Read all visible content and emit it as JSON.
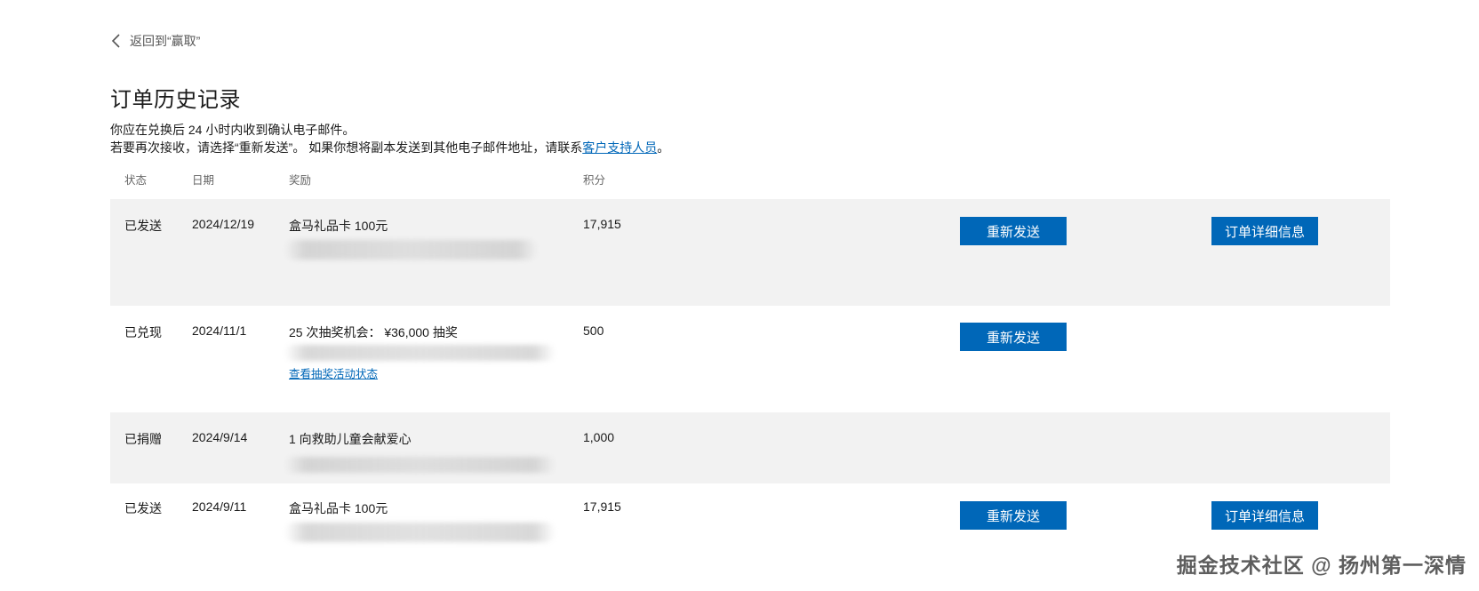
{
  "back": {
    "label": "返回到“赢取”"
  },
  "title": "订单历史记录",
  "intro": {
    "line1": "你应在兑换后 24 小时内收到确认电子邮件。",
    "line2_prefix": "若要再次接收，请选择“重新发送”。 如果你想将副本发送到其他电子邮件地址，请联系",
    "support_link": "客户支持人员",
    "line2_suffix": "。"
  },
  "columns": {
    "status": "状态",
    "date": "日期",
    "reward": "奖励",
    "points": "积分"
  },
  "orders": [
    {
      "status": "已发送",
      "date": "2024/12/19",
      "reward": "盒马礼品卡 100元",
      "points": "17,915",
      "resend": "重新发送",
      "details": "订单详细信息"
    },
    {
      "status": "已兑现",
      "date": "2024/11/1",
      "reward": "25 次抽奖机会： ¥36,000 抽奖",
      "points": "500",
      "resend": "重新发送",
      "link": "查看抽奖活动状态"
    },
    {
      "status": "已捐赠",
      "date": "2024/9/14",
      "reward": "1 向救助儿童会献爱心",
      "points": "1,000"
    },
    {
      "status": "已发送",
      "date": "2024/9/11",
      "reward": "盒马礼品卡 100元",
      "points": "17,915",
      "resend": "重新发送",
      "details": "订单详细信息"
    }
  ],
  "watermark": "掘金技术社区 @ 扬州第一深情",
  "colors": {
    "accent": "#0067b8",
    "row_shade": "#f2f2f2"
  }
}
